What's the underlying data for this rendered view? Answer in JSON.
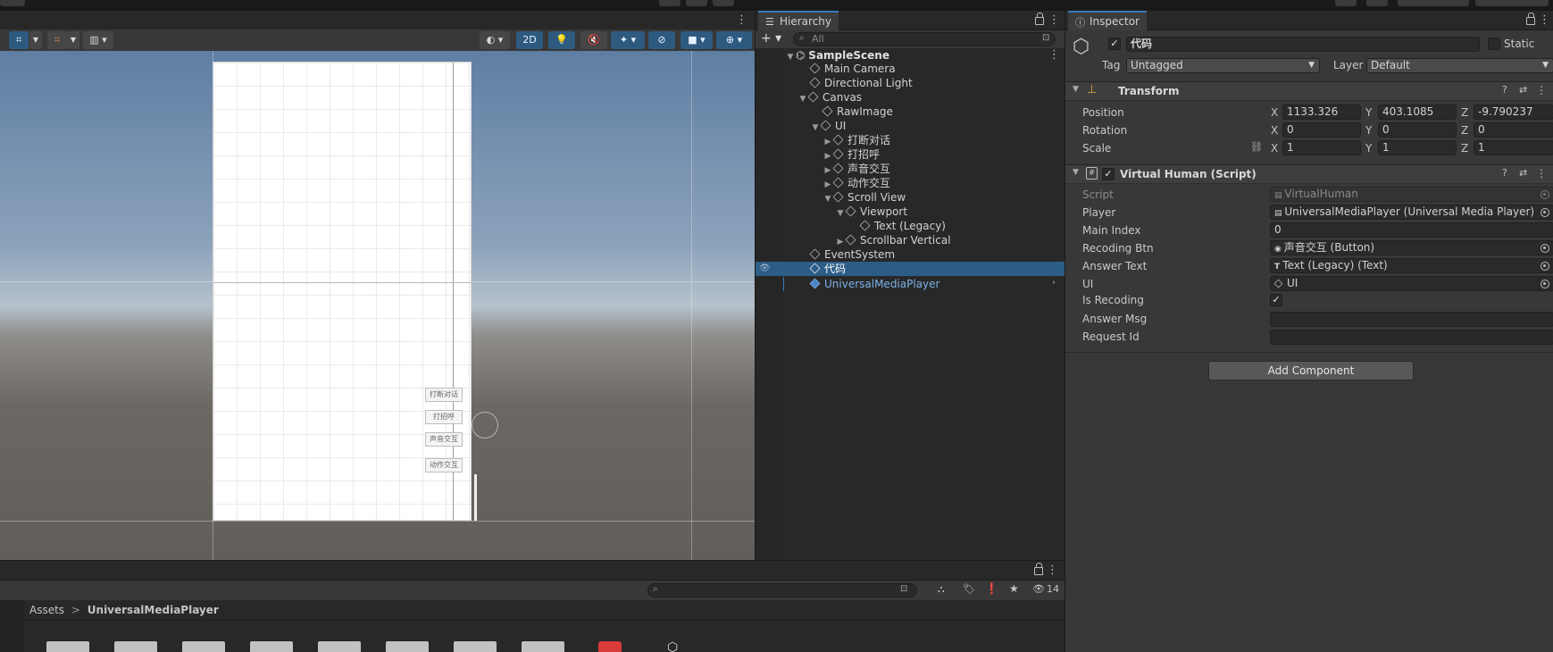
{
  "hierarchy": {
    "tab_label": "Hierarchy",
    "search_placeholder": "All",
    "scene": "SampleScene",
    "items": [
      {
        "label": "Main Camera"
      },
      {
        "label": "Directional Light"
      },
      {
        "label": "Canvas"
      },
      {
        "label": "RawImage"
      },
      {
        "label": "UI"
      },
      {
        "label": "打断对话"
      },
      {
        "label": "打招呼"
      },
      {
        "label": "声音交互"
      },
      {
        "label": "动作交互"
      },
      {
        "label": "Scroll View"
      },
      {
        "label": "Viewport"
      },
      {
        "label": "Text (Legacy)"
      },
      {
        "label": "Scrollbar Vertical"
      },
      {
        "label": "EventSystem"
      },
      {
        "label": "代码"
      },
      {
        "label": "UniversalMediaPlayer"
      }
    ]
  },
  "scene_toolbar": {
    "mode_2d": "2D"
  },
  "scene_canvas_buttons": [
    "打断对话",
    "打招呼",
    "声音交互",
    "动作交互"
  ],
  "inspector": {
    "tab_label": "Inspector",
    "object_name": "代码",
    "static_label": "Static",
    "tag_label": "Tag",
    "tag_value": "Untagged",
    "layer_label": "Layer",
    "layer_value": "Default",
    "transform": {
      "title": "Transform",
      "position_label": "Position",
      "rotation_label": "Rotation",
      "scale_label": "Scale",
      "x": "X",
      "y": "Y",
      "z": "Z",
      "position": [
        "1133.326",
        "403.1085",
        "-9.790237"
      ],
      "rotation": [
        "0",
        "0",
        "0"
      ],
      "scale": [
        "1",
        "1",
        "1"
      ]
    },
    "script_component": {
      "title": "Virtual Human (Script)",
      "fields": [
        {
          "label": "Script",
          "value": "VirtualHuman"
        },
        {
          "label": "Player",
          "value": "UniversalMediaPlayer (Universal Media Player)"
        },
        {
          "label": "Main Index",
          "value": "0"
        },
        {
          "label": "Recoding Btn",
          "value": "声音交互 (Button)"
        },
        {
          "label": "Answer Text",
          "value": "Text (Legacy) (Text)"
        },
        {
          "label": "UI",
          "value": "UI"
        },
        {
          "label": "Is Recoding",
          "value": "✓"
        },
        {
          "label": "Answer Msg",
          "value": ""
        },
        {
          "label": "Request Id",
          "value": ""
        }
      ]
    },
    "add_component": "Add Component"
  },
  "project": {
    "breadcrumb_root": "Assets",
    "breadcrumb_sep": ">",
    "breadcrumb_current": "UniversalMediaPlayer",
    "hidden_count": "14"
  },
  "colors": {
    "accent": "#2c5d87",
    "selection": "#2c5d87",
    "prefab": "#7cb1e8"
  }
}
